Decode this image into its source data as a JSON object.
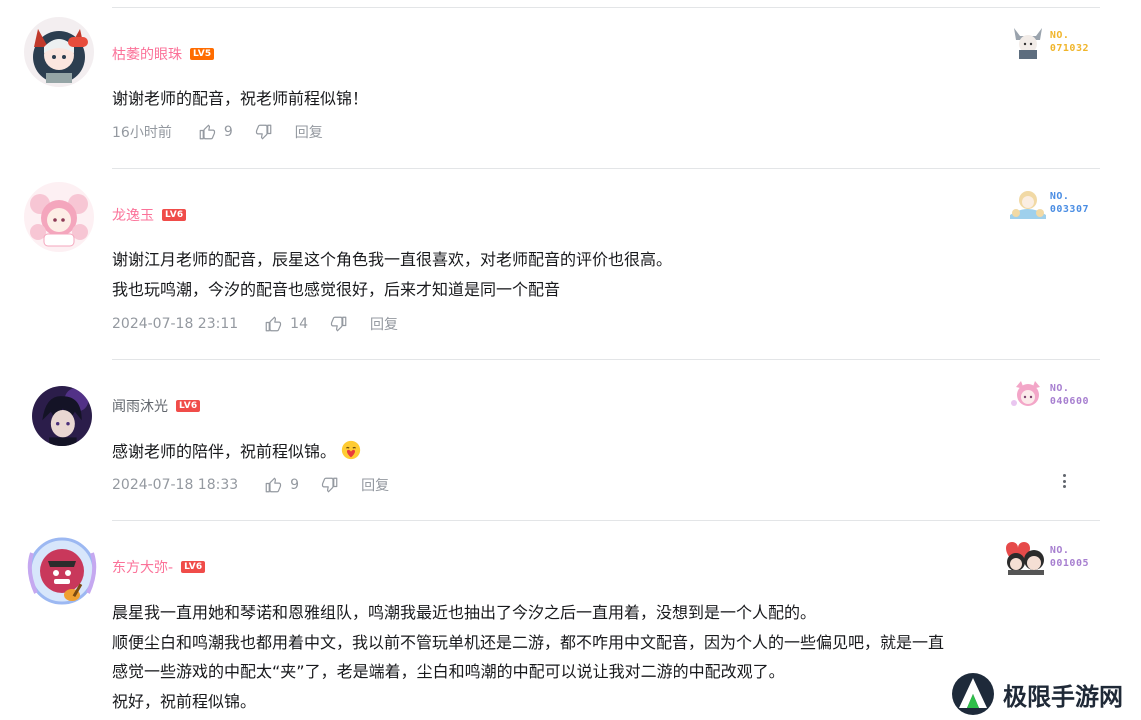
{
  "comments": [
    {
      "username": "枯萎的眼珠",
      "level": "LV5",
      "text_lines": [
        "谢谢老师的配音，祝老师前程似锦！"
      ],
      "time": "16小时前",
      "likes": "9",
      "reply_label": "回复",
      "fan_no_label": "NO.",
      "fan_no": "071032",
      "fan_color": "#f0b52b",
      "avatar_icon": "fox-girl-avatar-icon"
    },
    {
      "username": "龙逸玉",
      "level": "LV6",
      "text_lines": [
        "谢谢江月老师的配音，辰星这个角色我一直很喜欢，对老师配音的评价也很高。",
        "我也玩鸣潮，今汐的配音也感觉很好，后来才知道是同一个配音"
      ],
      "time": "2024-07-18 23:11",
      "likes": "14",
      "reply_label": "回复",
      "fan_no_label": "NO.",
      "fan_no": "003307",
      "fan_color": "#4a8de3",
      "avatar_icon": "pink-chibi-avatar-icon"
    },
    {
      "username": "闻雨沐光",
      "level": "LV6",
      "text_lines": [
        "感谢老师的陪伴，祝前程似锦。"
      ],
      "time": "2024-07-18 18:33",
      "likes": "9",
      "reply_label": "回复",
      "fan_no_label": "NO.",
      "fan_no": "040600",
      "fan_color": "#a77fd0",
      "avatar_icon": "dark-anime-boy-avatar-icon"
    },
    {
      "username": "东方大弥-",
      "level": "LV6",
      "text_lines": [
        "晨星我一直用她和琴诺和恩雅组队，鸣潮我最近也抽出了今汐之后一直用着，没想到是一个人配的。",
        "顺便尘白和鸣潮我也都用着中文，我以前不管玩单机还是二游，都不咋用中文配音，因为个人的一些偏见吧，就是一直",
        "感觉一些游戏的中配太“夹”了，老是端着，尘白和鸣潮的中配可以说让我对二游的中配改观了。",
        "祝好，祝前程似锦。"
      ],
      "fan_no_label": "NO.",
      "fan_no": "001005",
      "fan_color": "#a77fd0",
      "avatar_icon": "guitar-character-avatar-icon"
    }
  ],
  "watermark": {
    "text": "极限手游网"
  }
}
